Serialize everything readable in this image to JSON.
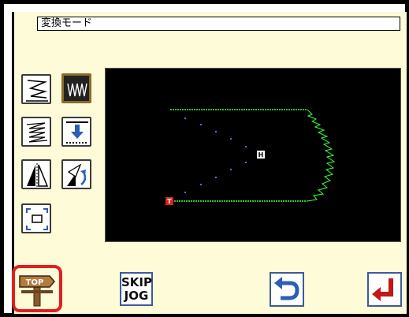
{
  "header": {
    "title": "変換モード"
  },
  "tools": [
    {
      "name": "step-pitch-icon"
    },
    {
      "name": "zigzag-icon",
      "active": true
    },
    {
      "name": "multi-stitch-icon"
    },
    {
      "name": "move-down-icon"
    },
    {
      "name": "mirror-icon"
    },
    {
      "name": "rotate-icon"
    },
    {
      "name": "scale-icon"
    }
  ],
  "canvas": {
    "start_marker": "T",
    "home_marker": "H",
    "colors": {
      "stitch": "#3dff3d",
      "start": "#e21e1e",
      "background": "#000000"
    }
  },
  "bottom": {
    "top_label": "TOP",
    "skip_line1": "SKIP",
    "skip_line2": "JOG"
  },
  "colors": {
    "screen_bg": "#fdfbd8",
    "accent_blue": "#2b5fb3",
    "highlight_red": "#e21e1e"
  }
}
